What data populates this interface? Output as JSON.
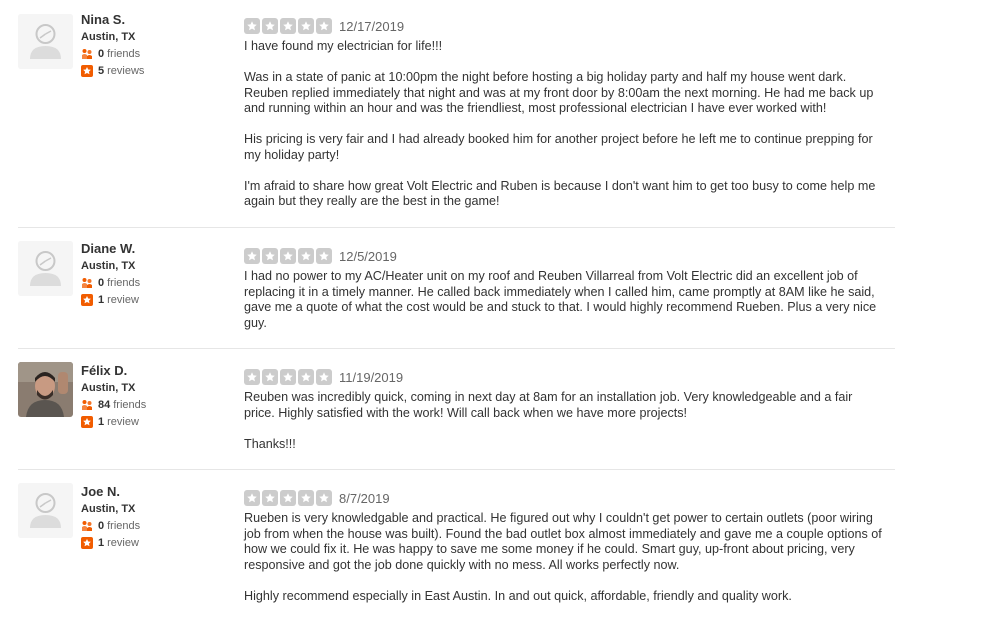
{
  "reviews": [
    {
      "name": "Nina S.",
      "location": "Austin, TX",
      "friends_count": "0",
      "friends_label": "friends",
      "reviews_count": "5",
      "reviews_label": "reviews",
      "avatar": "default-avatar",
      "rating": 5,
      "date": "12/17/2019",
      "paragraphs": [
        "I have found my electrician for life!!!",
        "Was in a state of panic at 10:00pm the night before hosting a big holiday party and half my house went dark. Reuben replied immediately that night and was at my front door by 8:00am the next morning. He had me back up and running within an hour and was the friendliest, most professional electrician I have ever worked with!",
        "His pricing is very fair and I had already booked him for another project before he left me to continue prepping for my holiday party!",
        "I'm afraid to share how great Volt Electric and Ruben is because I don't want him to get too busy to come help me again but they really are the best in the game!"
      ]
    },
    {
      "name": "Diane W.",
      "location": "Austin, TX",
      "friends_count": "0",
      "friends_label": "friends",
      "reviews_count": "1",
      "reviews_label": "review",
      "avatar": "default-avatar",
      "rating": 5,
      "date": "12/5/2019",
      "paragraphs": [
        "I had no power to my AC/Heater unit on my roof and Reuben Villarreal from Volt Electric did an excellent job of replacing it in a timely manner. He called back immediately when I called him, came promptly at 8AM like he said, gave me a quote of what the cost would be and stuck to that. I would highly recommend Rueben. Plus a very nice guy."
      ]
    },
    {
      "name": "Félix D.",
      "location": "Austin, TX",
      "friends_count": "84",
      "friends_label": "friends",
      "reviews_count": "1",
      "reviews_label": "review",
      "avatar": "photo-avatar",
      "rating": 5,
      "date": "11/19/2019",
      "paragraphs": [
        "Reuben was incredibly quick, coming in next day at 8am for an installation job. Very knowledgeable and a fair price. Highly satisfied with the work! Will call back when we have more projects!",
        "Thanks!!!"
      ]
    },
    {
      "name": "Joe N.",
      "location": "Austin, TX",
      "friends_count": "0",
      "friends_label": "friends",
      "reviews_count": "1",
      "reviews_label": "review",
      "avatar": "default-avatar",
      "rating": 5,
      "date": "8/7/2019",
      "paragraphs": [
        "Rueben is very knowledgable and practical. He figured out why I couldn't get power to certain outlets (poor wiring job from when the house was built). Found the bad outlet box almost immediately and gave me a couple options of how we could fix it. He was happy to save me some money if he could. Smart guy, up-front about pricing, very responsive and got the job done quickly with no mess. All works perfectly now.",
        "Highly recommend especially in East Austin. In and out quick, affordable, friendly and quality work."
      ]
    }
  ],
  "colors": {
    "star_empty": "#cccccc",
    "friends_icon": "#f15c00",
    "reviews_icon": "#f15c00",
    "text": "#333333",
    "divider": "#e6e6e6"
  }
}
